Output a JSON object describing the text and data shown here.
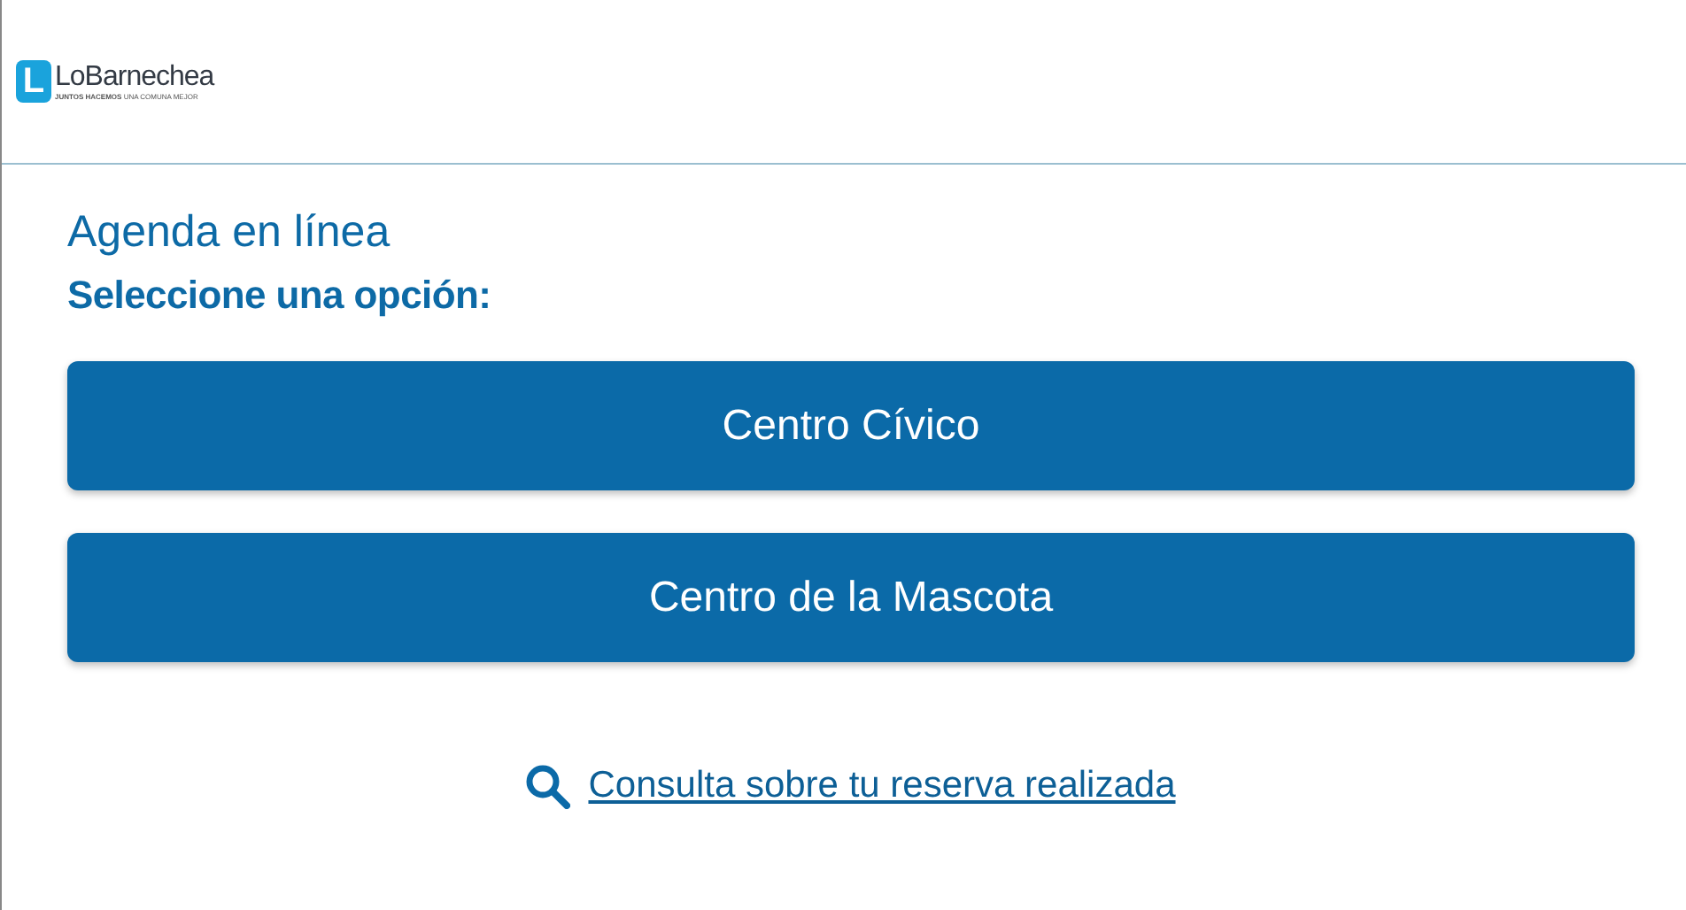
{
  "header": {
    "logo_letter": "L",
    "logo_name": "LoBarnechea",
    "logo_tagline": "**JUNTOS HACEMOS** UNA COMUNA MEJOR"
  },
  "title": "Agenda en línea",
  "subtitle": "Seleccione una opción:",
  "options": [
    {
      "label": "Centro Cívico"
    },
    {
      "label": "Centro de la Mascota"
    }
  ],
  "link": "Consulta sobre tu reserva realizada"
}
